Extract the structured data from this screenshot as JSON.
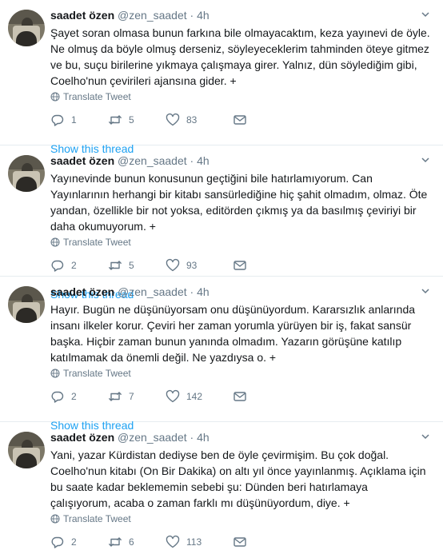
{
  "tweets": [
    {
      "name": "saadet özen",
      "handle": "@zen_saadet",
      "separator": "·",
      "time": "4h",
      "text": "Şayet soran olmasa bunun farkına bile olmayacaktım, keza yayınevi de öyle. Ne olmuş da böyle olmuş derseniz, söyleyeceklerim tahminden öteye gitmez ve bu, suçu birilerine yıkmaya çalışmaya girer. Yalnız, dün söylediğim gibi,  Coelho'nun çevirileri ajansına gider. +",
      "translate": "Translate Tweet",
      "replies": "1",
      "retweets": "5",
      "likes": "83",
      "show_thread": "Show this thread"
    },
    {
      "name": "saadet özen",
      "handle": "@zen_saadet",
      "separator": "·",
      "time": "4h",
      "text": "Yayınevinde bunun konusunun geçtiğini bile hatırlamıyorum. Can Yayınlarının herhangi bir kitabı sansürlediğine hiç şahit olmadım, olmaz. Öte yandan, özellikle bir not yoksa, editörden çıkmış ya da basılmış çeviriyi bir daha okumuyorum. +",
      "translate": "Translate Tweet",
      "replies": "2",
      "retweets": "5",
      "likes": "93",
      "show_thread": "Show this thread"
    },
    {
      "name": "saadet özen",
      "handle": "@zen_saadet",
      "separator": "·",
      "time": "4h",
      "text": "Hayır. Bugün ne düşünüyorsam onu düşünüyordum. Kararsızlık anlarında insanı ilkeler korur. Çeviri her zaman yorumla yürüyen bir iş, fakat sansür başka. Hiçbir zaman bunun yanında olmadım. Yazarın görüşüne katılıp katılmamak da önemli değil. Ne yazdıysa o. +",
      "translate": "Translate Tweet",
      "replies": "2",
      "retweets": "7",
      "likes": "142",
      "show_thread": "Show this thread"
    },
    {
      "name": "saadet özen",
      "handle": "@zen_saadet",
      "separator": "·",
      "time": "4h",
      "text": "Yani, yazar Kürdistan dediyse ben de öyle çevirmişim. Bu çok doğal. Coelho'nun kitabı (On Bir Dakika) on altı yıl önce yayınlanmış. Açıklama için bu saate kadar beklememin sebebi şu: Dünden beri hatırlamaya çalışıyorum, acaba o zaman farklı mı düşünüyordum, diye. +",
      "translate": "Translate Tweet",
      "replies": "2",
      "retweets": "6",
      "likes": "113"
    }
  ],
  "icons": {
    "reply": "reply-icon",
    "retweet": "retweet-icon",
    "like": "heart-icon",
    "message": "direct-message-icon",
    "translate": "globe-icon",
    "menu": "chevron-down-icon"
  },
  "colors": {
    "link": "#1da1f2",
    "secondary_text": "#657786",
    "divider": "#e6ecf0"
  }
}
